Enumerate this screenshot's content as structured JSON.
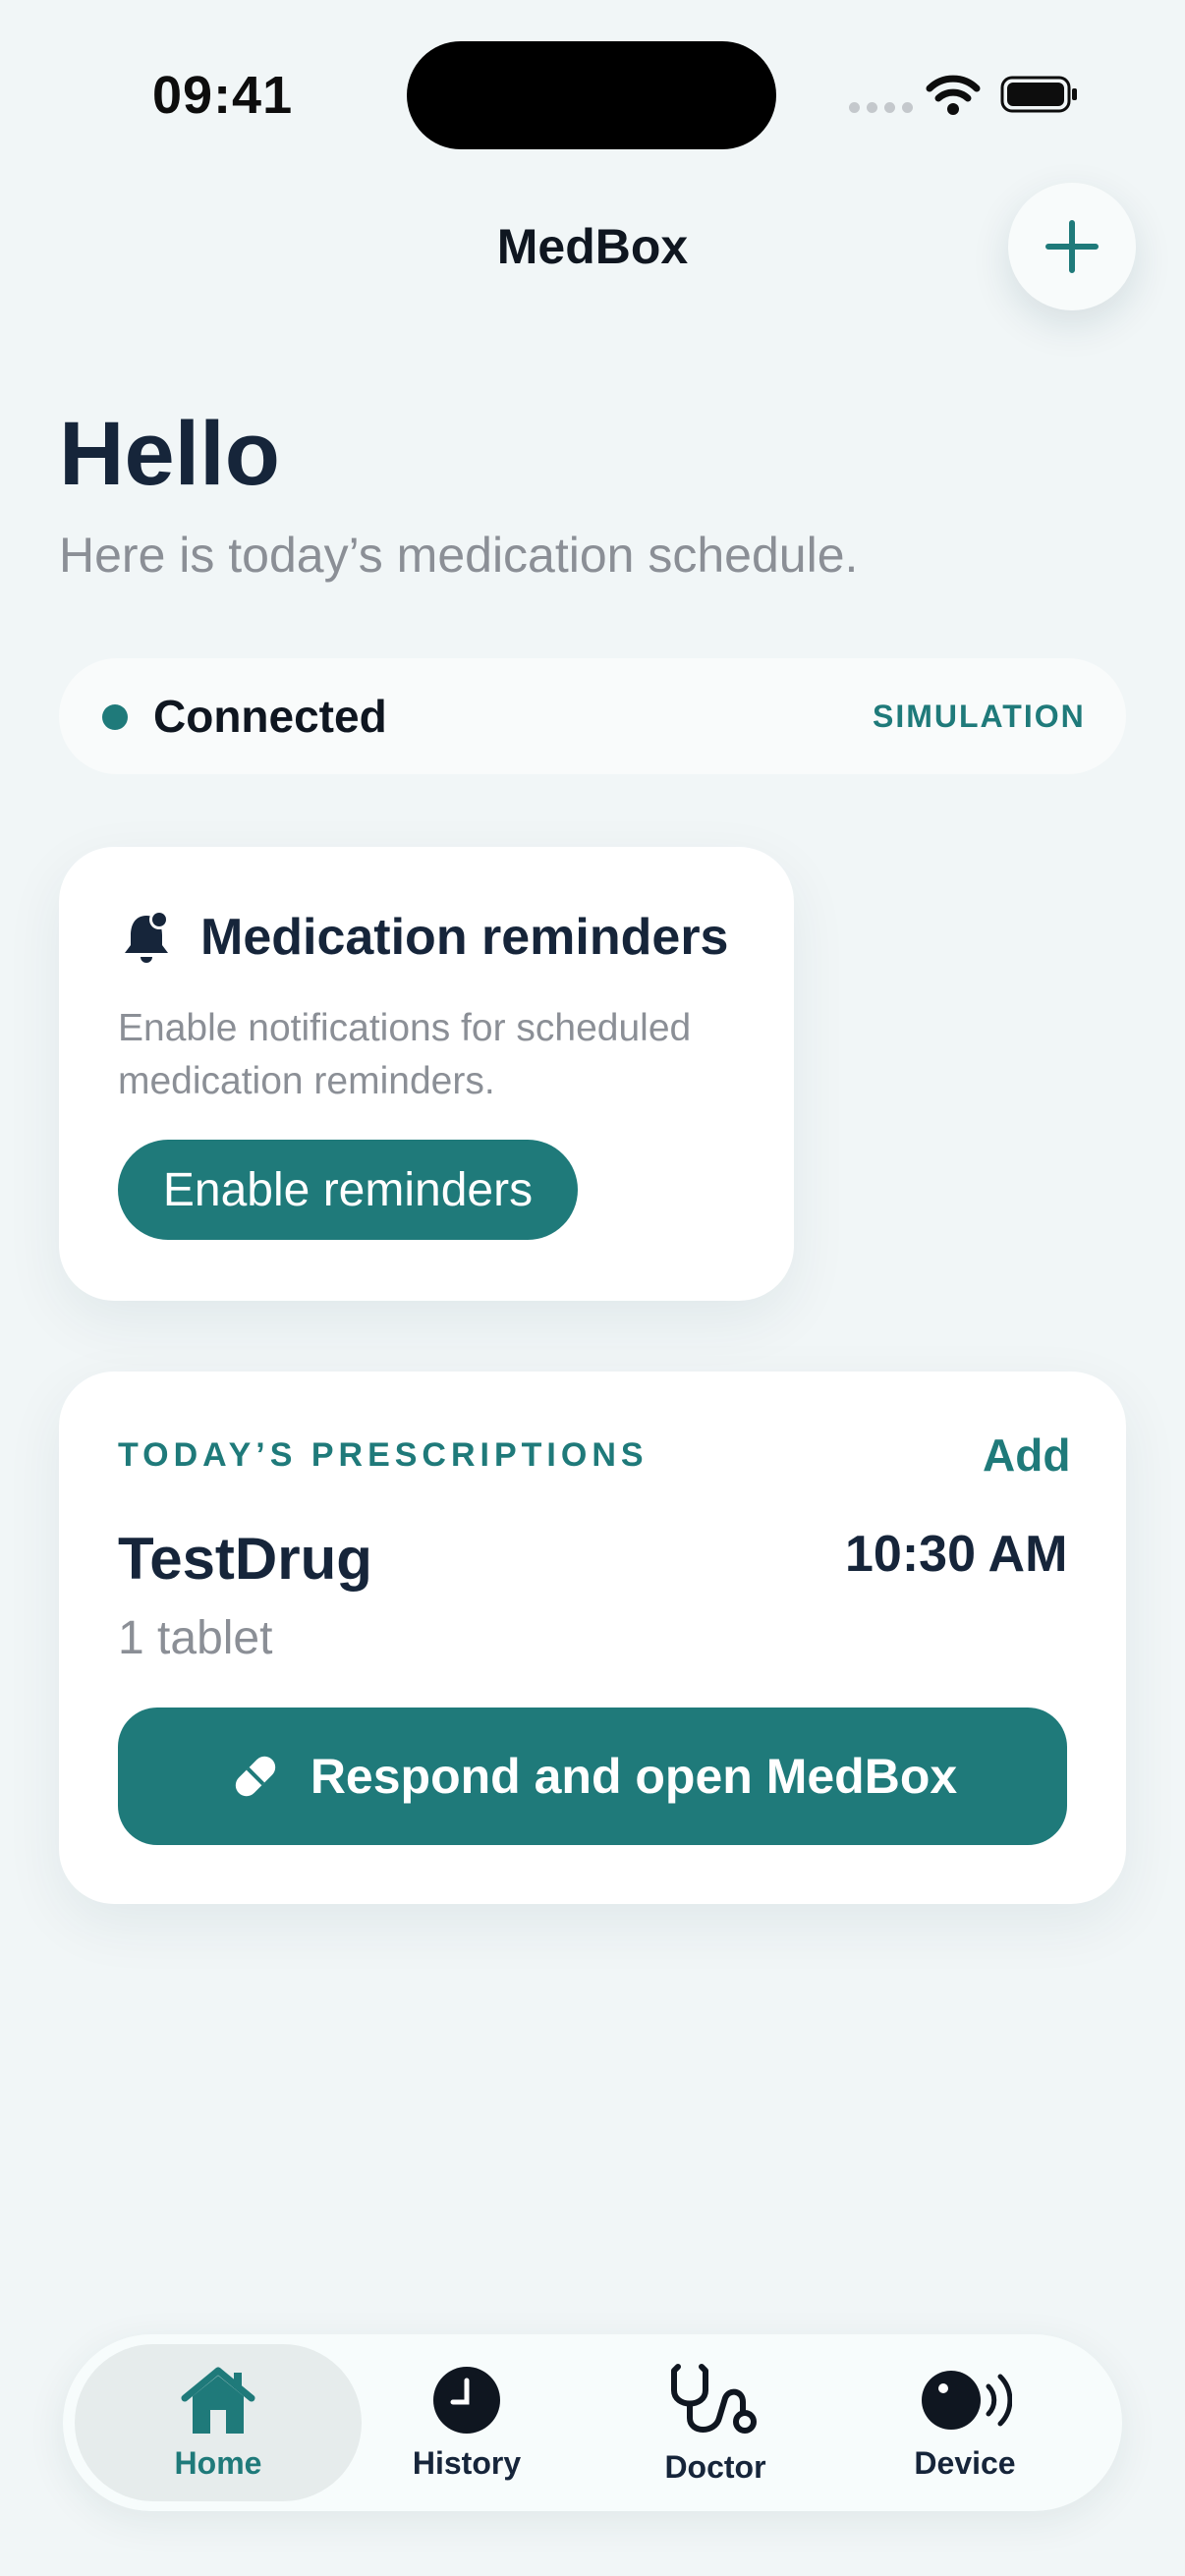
{
  "status_bar": {
    "time": "09:41"
  },
  "nav": {
    "title": "MedBox",
    "add_icon": "plus-icon"
  },
  "greeting": {
    "title": "Hello",
    "subtitle": "Here is today’s medication schedule."
  },
  "connection": {
    "status": "Connected",
    "mode_badge": "SIMULATION",
    "status_color": "#1f7a7a"
  },
  "reminders_card": {
    "title": "Medication reminders",
    "description": "Enable notifications for scheduled medication reminders.",
    "button_label": "Enable reminders",
    "icon": "bell-badge-icon"
  },
  "prescriptions": {
    "heading": "TODAY’S PRESCRIPTIONS",
    "add_label": "Add",
    "items": [
      {
        "name": "TestDrug",
        "time": "10:30 AM",
        "dose": "1 tablet"
      }
    ],
    "respond_button_label": "Respond and open MedBox",
    "respond_icon": "pill-icon"
  },
  "tabbar": {
    "tabs": [
      {
        "label": "Home",
        "icon": "house-icon",
        "active": true
      },
      {
        "label": "History",
        "icon": "clock-icon",
        "active": false
      },
      {
        "label": "Doctor",
        "icon": "stethoscope-icon",
        "active": false
      },
      {
        "label": "Device",
        "icon": "device-signal-icon",
        "active": false
      }
    ]
  },
  "colors": {
    "accent": "#1f7a7a",
    "background": "#f1f6f7",
    "text": "#16253a",
    "muted": "#8b8f96"
  }
}
